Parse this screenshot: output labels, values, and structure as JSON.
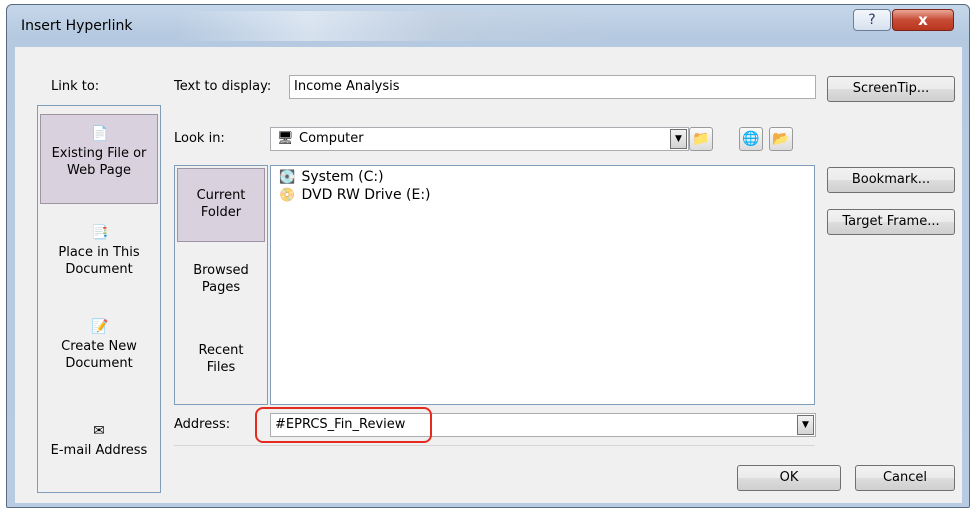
{
  "window": {
    "title": "Insert Hyperlink",
    "help_label": "?",
    "close_label": "x"
  },
  "link_to": {
    "label": "Link to:",
    "items": [
      {
        "line1": "Existing File or",
        "line2": "Web Page",
        "icon": "file-icon"
      },
      {
        "line1": "Place in This",
        "line2": "Document",
        "icon": "document-icon"
      },
      {
        "line1": "Create New",
        "line2": "Document",
        "icon": "new-document-icon"
      },
      {
        "line1": "E-mail Address",
        "line2": "",
        "icon": "email-icon"
      }
    ]
  },
  "text_to_display": {
    "label": "Text to display:",
    "value": "Income Analysis"
  },
  "look_in": {
    "label": "Look in:",
    "value": "Computer"
  },
  "nav": {
    "items": [
      {
        "line1": "Current",
        "line2": "Folder"
      },
      {
        "line1": "Browsed",
        "line2": "Pages"
      },
      {
        "line1": "Recent",
        "line2": "Files"
      }
    ]
  },
  "files": [
    {
      "name": "System (C:)",
      "icon": "hard-drive-icon"
    },
    {
      "name": "DVD RW Drive (E:)",
      "icon": "dvd-drive-icon"
    }
  ],
  "address": {
    "label": "Address:",
    "value": "#EPRCS_Fin_Review"
  },
  "buttons": {
    "screentip": "ScreenTip...",
    "bookmark": "Bookmark...",
    "target_frame": "Target Frame...",
    "ok": "OK",
    "cancel": "Cancel"
  },
  "colors": {
    "highlight": "#e52b1e",
    "selected_item": "#d9d2de"
  }
}
